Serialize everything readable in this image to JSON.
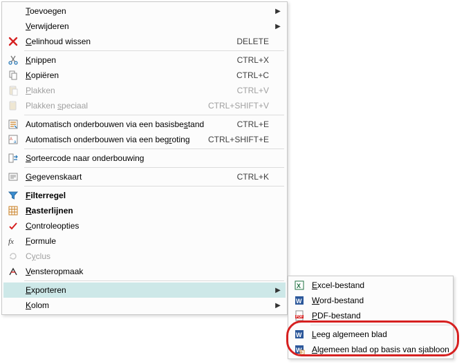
{
  "main": {
    "toevoegen": {
      "label": "Toevoegen",
      "mnemonic": 0
    },
    "verwijderen": {
      "label": "Verwijderen",
      "mnemonic": 0
    },
    "celinhoud": {
      "label": "Celinhoud wissen",
      "mnemonic": 0,
      "shortcut": "DELETE"
    },
    "knippen": {
      "label": "Knippen",
      "mnemonic": 0,
      "shortcut": "CTRL+X"
    },
    "kopieren": {
      "label": "Kopiëren",
      "mnemonic": 0,
      "shortcut": "CTRL+C"
    },
    "plakken": {
      "label": "Plakken",
      "mnemonic": 0,
      "shortcut": "CTRL+V"
    },
    "plakkenspeciaal": {
      "label": "Plakken speciaal",
      "mnemonic": 8,
      "shortcut": "CTRL+SHIFT+V"
    },
    "autobasis": {
      "label": "Automatisch onderbouwen via een basisbestand",
      "mnemonic": 39,
      "shortcut": "CTRL+E"
    },
    "autobegroting": {
      "label": "Automatisch onderbouwen via een begroting",
      "mnemonic": 35,
      "shortcut": "CTRL+SHIFT+E"
    },
    "sorteer": {
      "label": "Sorteercode naar onderbouwing",
      "mnemonic": 0
    },
    "gegevenskaart": {
      "label": "Gegevenskaart",
      "mnemonic": 0,
      "shortcut": "CTRL+K"
    },
    "filterregel": {
      "label": "Filterregel",
      "mnemonic": 0
    },
    "rasterlijnen": {
      "label": "Rasterlijnen",
      "mnemonic": 0
    },
    "controleopties": {
      "label": "Controleopties",
      "mnemonic": 0
    },
    "formule": {
      "label": "Formule",
      "mnemonic": 0
    },
    "cyclus": {
      "label": "Cyclus",
      "mnemonic": 1
    },
    "vensteropmaak": {
      "label": "Vensteropmaak",
      "mnemonic": 0
    },
    "exporteren": {
      "label": "Exporteren",
      "mnemonic": 0
    },
    "kolom": {
      "label": "Kolom",
      "mnemonic": 0
    }
  },
  "sub": {
    "excel": {
      "label": "Excel-bestand",
      "mnemonic": 0
    },
    "word": {
      "label": "Word-bestand",
      "mnemonic": 0
    },
    "pdf": {
      "label": "PDF-bestand",
      "mnemonic": 0
    },
    "leeg": {
      "label": "Leeg algemeen blad",
      "mnemonic": 0
    },
    "algemeen": {
      "label": "Algemeen blad op basis van sjabloon",
      "mnemonic": 0
    }
  }
}
